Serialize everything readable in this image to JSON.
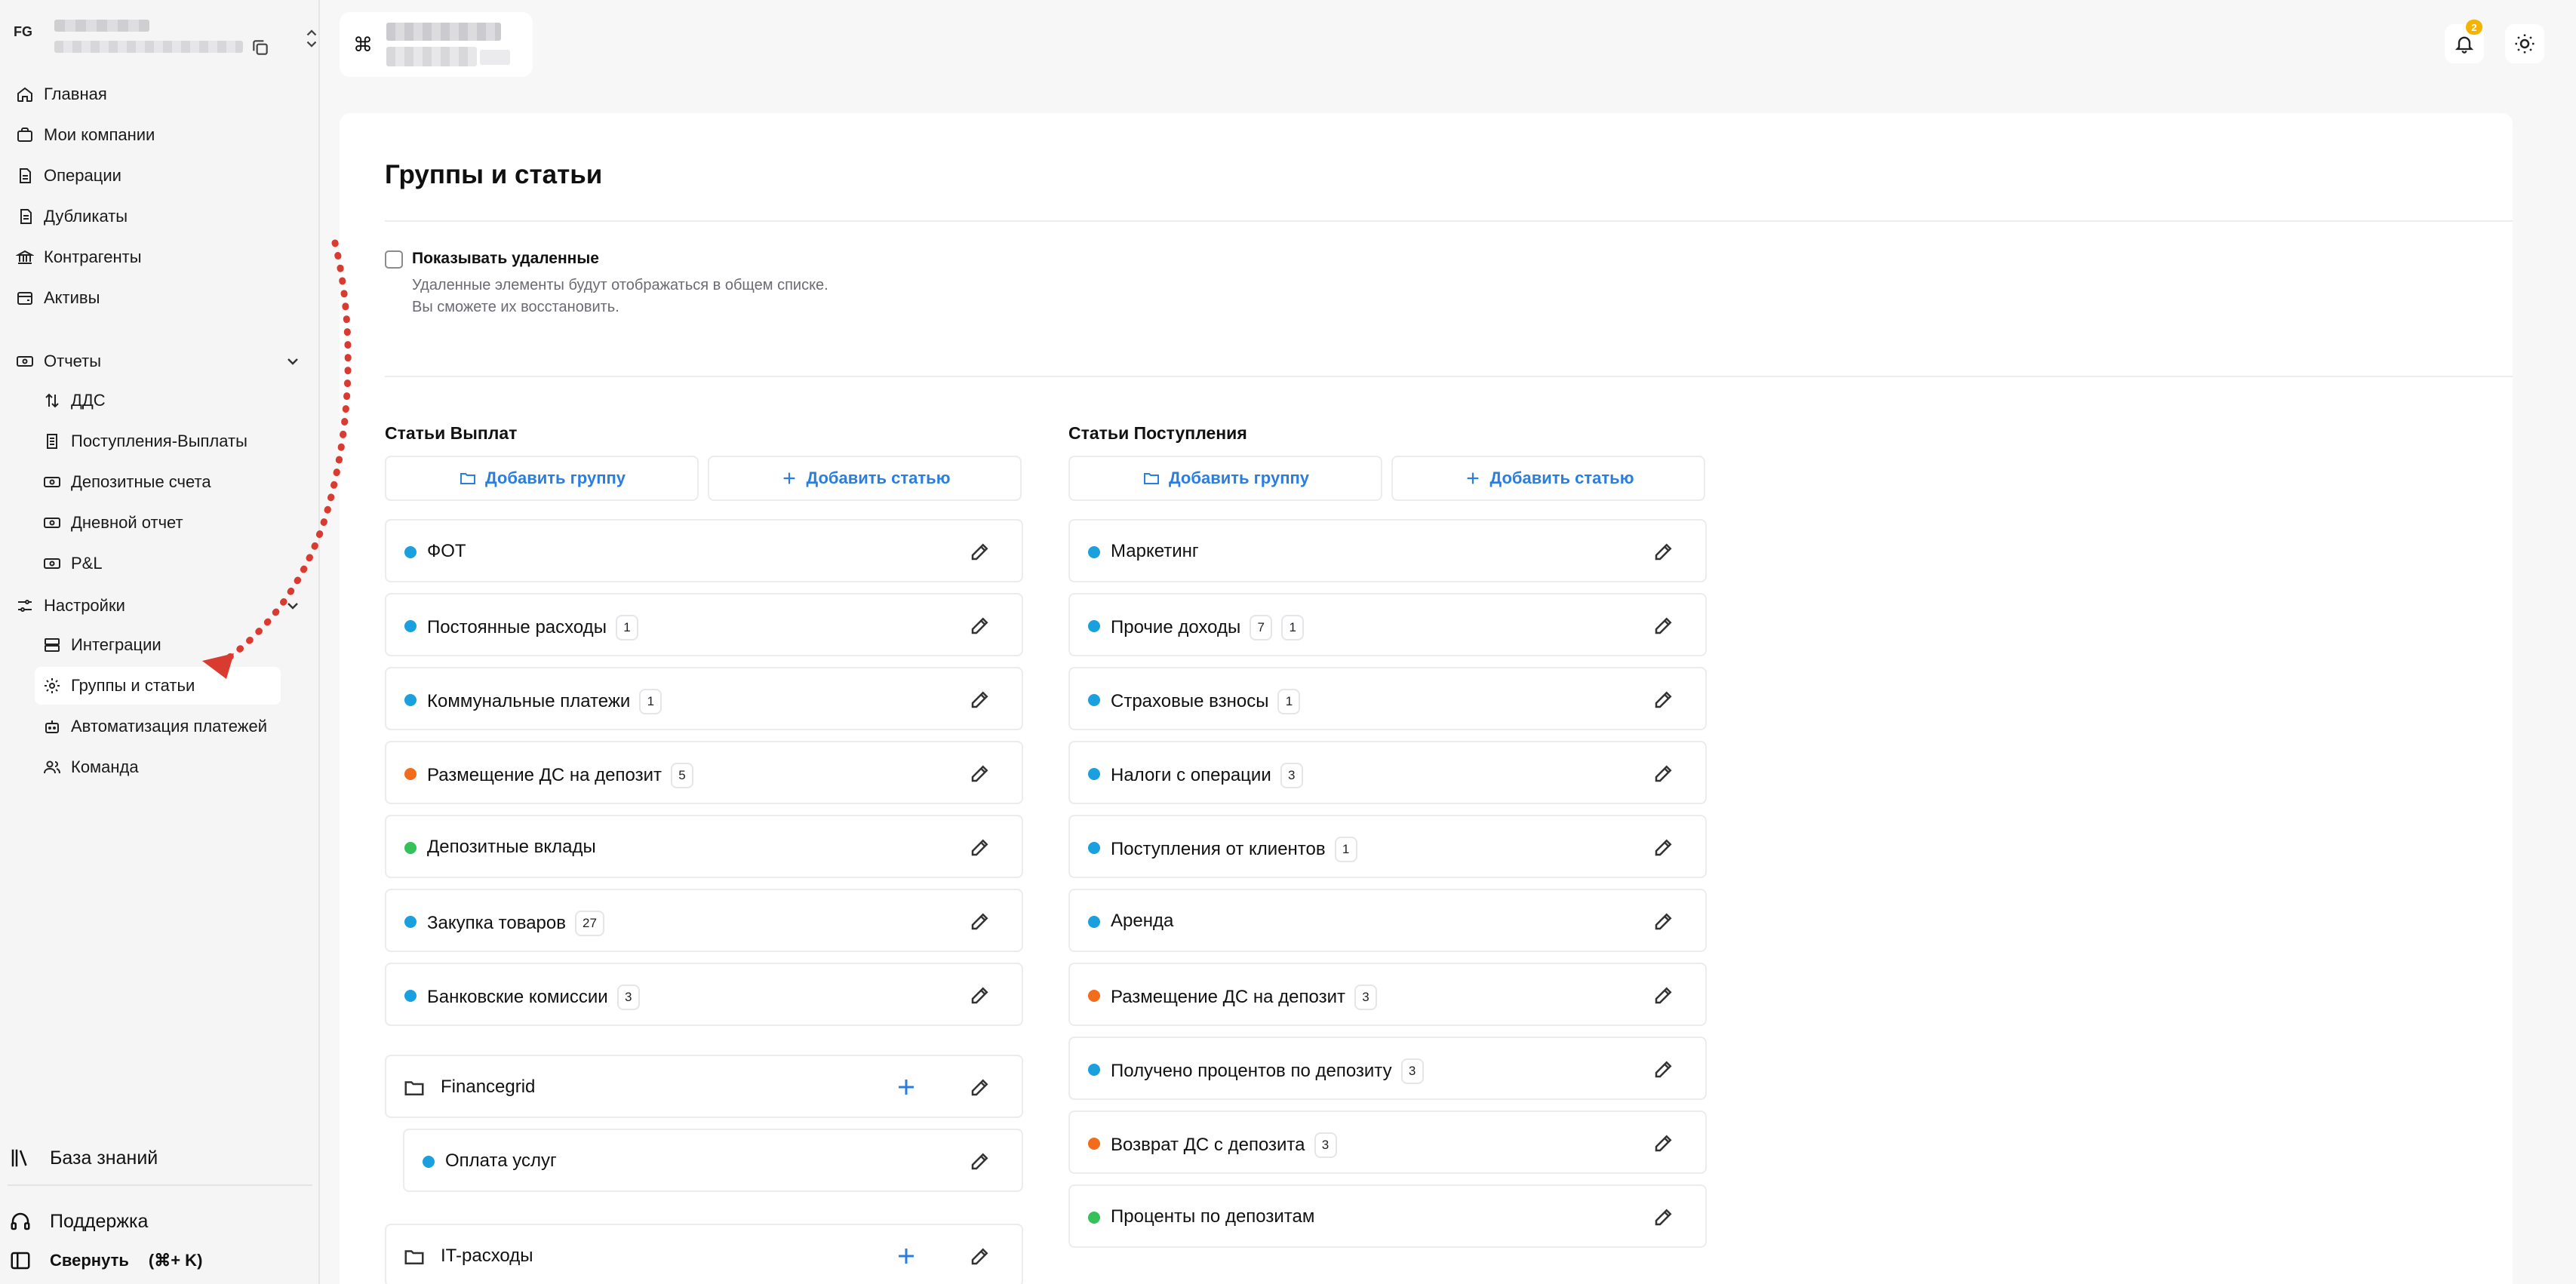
{
  "sidebar": {
    "workspace_initials": "FG",
    "nav": [
      {
        "label": "Главная"
      },
      {
        "label": "Мои компании"
      },
      {
        "label": "Операции"
      },
      {
        "label": "Дубликаты"
      },
      {
        "label": "Контрагенты"
      },
      {
        "label": "Активы"
      }
    ],
    "reports": {
      "label": "Отчеты",
      "items": [
        {
          "label": "ДДС"
        },
        {
          "label": "Поступления-Выплаты"
        },
        {
          "label": "Депозитные счета"
        },
        {
          "label": "Дневной отчет"
        },
        {
          "label": "P&L"
        }
      ]
    },
    "settings": {
      "label": "Настройки",
      "items": [
        {
          "label": "Интеграции"
        },
        {
          "label": "Группы и статьи"
        },
        {
          "label": "Автоматизация платежей"
        },
        {
          "label": "Команда"
        }
      ]
    },
    "bottom": {
      "knowledge": "База знаний",
      "support": "Поддержка",
      "collapse": "Свернуть",
      "collapse_shortcut": "(⌘+ K)"
    }
  },
  "topbar": {
    "cmd_symbol": "⌘",
    "notifications_count": "2"
  },
  "page": {
    "title": "Группы и статьи",
    "show_deleted": {
      "label": "Показывать удаленные",
      "desc_line1": "Удаленные элементы будут отображаться в общем списке.",
      "desc_line2": "Вы сможете их восстановить.",
      "checked": false
    }
  },
  "payouts": {
    "title": "Статьи Выплат",
    "add_group": "Добавить группу",
    "add_item": "Добавить статью",
    "items": [
      {
        "name": "ФОТ",
        "count": "",
        "color": "#1a9fdf"
      },
      {
        "name": "Постоянные расходы",
        "count": "1",
        "color": "#1a9fdf"
      },
      {
        "name": "Коммунальные платежи",
        "count": "1",
        "color": "#1a9fdf"
      },
      {
        "name": "Размещение ДС на депозит",
        "count": "5",
        "color": "#f26c1d"
      },
      {
        "name": "Депозитные вклады",
        "count": "",
        "color": "#34c15a"
      },
      {
        "name": "Закупка товаров",
        "count": "27",
        "color": "#1a9fdf"
      },
      {
        "name": "Банковские комиссии",
        "count": "3",
        "color": "#1a9fdf"
      }
    ],
    "groups": [
      {
        "name": "Financegrid",
        "children": [
          {
            "name": "Оплата услуг",
            "color": "#1a9fdf"
          }
        ]
      },
      {
        "name": "IT-расходы"
      }
    ]
  },
  "receipts": {
    "title": "Статьи Поступления",
    "add_group": "Добавить группу",
    "add_item": "Добавить статью",
    "items": [
      {
        "name": "Маркетинг",
        "counts": [],
        "color": "#1a9fdf"
      },
      {
        "name": "Прочие доходы",
        "counts": [
          "7",
          "1"
        ],
        "color": "#1a9fdf"
      },
      {
        "name": "Страховые взносы",
        "counts": [
          "1"
        ],
        "color": "#1a9fdf"
      },
      {
        "name": "Налоги с операции",
        "counts": [
          "3"
        ],
        "color": "#1a9fdf"
      },
      {
        "name": "Поступления от клиентов",
        "counts": [
          "1"
        ],
        "color": "#1a9fdf"
      },
      {
        "name": "Аренда",
        "counts": [],
        "color": "#1a9fdf"
      },
      {
        "name": "Размещение ДС на депозит",
        "counts": [
          "3"
        ],
        "color": "#f26c1d"
      },
      {
        "name": "Получено процентов по депозиту",
        "counts": [
          "3"
        ],
        "color": "#1a9fdf"
      },
      {
        "name": "Возврат ДС с депозита",
        "counts": [
          "3"
        ],
        "color": "#f26c1d"
      },
      {
        "name": "Проценты по депозитам",
        "counts": [],
        "color": "#34c15a"
      }
    ]
  },
  "colors": {
    "accent": "#2a7de1",
    "annotation_arrow": "#d93b30"
  }
}
